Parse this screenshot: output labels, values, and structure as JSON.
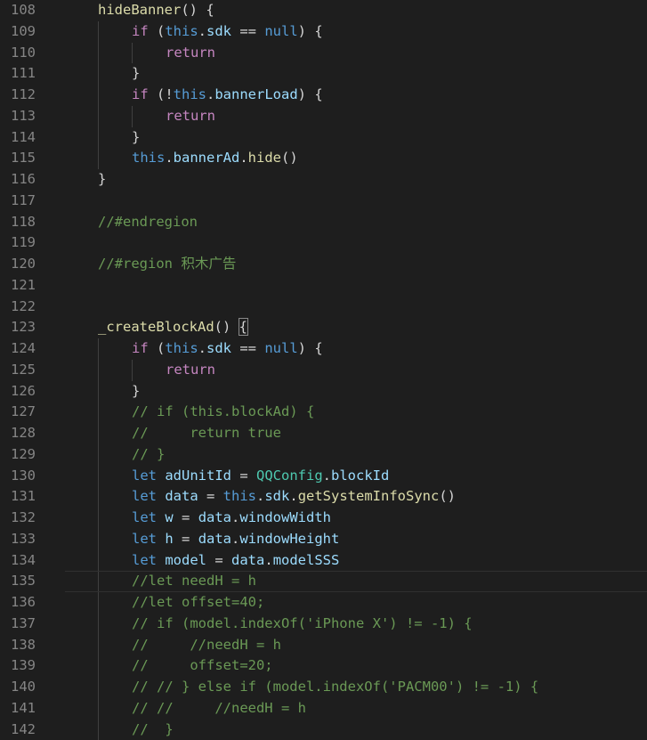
{
  "editor": {
    "colors": {
      "background": "#1e1e1e",
      "line_number": "#858585",
      "function": "#dcdcaa",
      "keyword": "#c586c0",
      "constant": "#569cd6",
      "variable": "#9cdcfe",
      "class": "#4ec9b0",
      "comment": "#6a9955",
      "text": "#d4d4d4"
    },
    "current_line": 135,
    "lines": [
      {
        "n": "108",
        "indent": 1,
        "tokens": [
          {
            "t": "hideBanner",
            "c": "func"
          },
          {
            "t": "() {",
            "c": "plain"
          }
        ]
      },
      {
        "n": "109",
        "indent": 2,
        "tokens": [
          {
            "t": "if",
            "c": "kw"
          },
          {
            "t": " (",
            "c": "plain"
          },
          {
            "t": "this",
            "c": "const"
          },
          {
            "t": ".",
            "c": "plain"
          },
          {
            "t": "sdk",
            "c": "var"
          },
          {
            "t": " == ",
            "c": "plain"
          },
          {
            "t": "null",
            "c": "const"
          },
          {
            "t": ") {",
            "c": "plain"
          }
        ]
      },
      {
        "n": "110",
        "indent": 3,
        "tokens": [
          {
            "t": "return",
            "c": "kw"
          }
        ]
      },
      {
        "n": "111",
        "indent": 2,
        "tokens": [
          {
            "t": "}",
            "c": "plain"
          }
        ]
      },
      {
        "n": "112",
        "indent": 2,
        "tokens": [
          {
            "t": "if",
            "c": "kw"
          },
          {
            "t": " (!",
            "c": "plain"
          },
          {
            "t": "this",
            "c": "const"
          },
          {
            "t": ".",
            "c": "plain"
          },
          {
            "t": "bannerLoad",
            "c": "var"
          },
          {
            "t": ") {",
            "c": "plain"
          }
        ]
      },
      {
        "n": "113",
        "indent": 3,
        "tokens": [
          {
            "t": "return",
            "c": "kw"
          }
        ]
      },
      {
        "n": "114",
        "indent": 2,
        "tokens": [
          {
            "t": "}",
            "c": "plain"
          }
        ]
      },
      {
        "n": "115",
        "indent": 2,
        "tokens": [
          {
            "t": "this",
            "c": "const"
          },
          {
            "t": ".",
            "c": "plain"
          },
          {
            "t": "bannerAd",
            "c": "var"
          },
          {
            "t": ".",
            "c": "plain"
          },
          {
            "t": "hide",
            "c": "func"
          },
          {
            "t": "()",
            "c": "plain"
          }
        ]
      },
      {
        "n": "116",
        "indent": 1,
        "tokens": [
          {
            "t": "}",
            "c": "plain"
          }
        ]
      },
      {
        "n": "117",
        "indent": 0,
        "tokens": []
      },
      {
        "n": "118",
        "indent": 1,
        "tokens": [
          {
            "t": "//#endregion",
            "c": "comment"
          }
        ]
      },
      {
        "n": "119",
        "indent": 0,
        "tokens": []
      },
      {
        "n": "120",
        "indent": 1,
        "tokens": [
          {
            "t": "//#region 积木广告",
            "c": "comment"
          }
        ]
      },
      {
        "n": "121",
        "indent": 0,
        "tokens": []
      },
      {
        "n": "122",
        "indent": 0,
        "tokens": []
      },
      {
        "n": "123",
        "indent": 1,
        "tokens": [
          {
            "t": "_createBlockAd",
            "c": "func"
          },
          {
            "t": "() ",
            "c": "plain"
          },
          {
            "t": "{",
            "c": "bracket"
          }
        ]
      },
      {
        "n": "124",
        "indent": 2,
        "tokens": [
          {
            "t": "if",
            "c": "kw"
          },
          {
            "t": " (",
            "c": "plain"
          },
          {
            "t": "this",
            "c": "const"
          },
          {
            "t": ".",
            "c": "plain"
          },
          {
            "t": "sdk",
            "c": "var"
          },
          {
            "t": " == ",
            "c": "plain"
          },
          {
            "t": "null",
            "c": "const"
          },
          {
            "t": ") {",
            "c": "plain"
          }
        ]
      },
      {
        "n": "125",
        "indent": 3,
        "tokens": [
          {
            "t": "return",
            "c": "kw"
          }
        ]
      },
      {
        "n": "126",
        "indent": 2,
        "tokens": [
          {
            "t": "}",
            "c": "plain"
          }
        ]
      },
      {
        "n": "127",
        "indent": 2,
        "tokens": [
          {
            "t": "// if (this.blockAd) {",
            "c": "comment"
          }
        ]
      },
      {
        "n": "128",
        "indent": 2,
        "tokens": [
          {
            "t": "//     return true",
            "c": "comment"
          }
        ]
      },
      {
        "n": "129",
        "indent": 2,
        "tokens": [
          {
            "t": "// }",
            "c": "comment"
          }
        ]
      },
      {
        "n": "130",
        "indent": 2,
        "tokens": [
          {
            "t": "let",
            "c": "const"
          },
          {
            "t": " ",
            "c": "plain"
          },
          {
            "t": "adUnitId",
            "c": "var"
          },
          {
            "t": " = ",
            "c": "plain"
          },
          {
            "t": "QQConfig",
            "c": "class"
          },
          {
            "t": ".",
            "c": "plain"
          },
          {
            "t": "blockId",
            "c": "var"
          }
        ]
      },
      {
        "n": "131",
        "indent": 2,
        "tokens": [
          {
            "t": "let",
            "c": "const"
          },
          {
            "t": " ",
            "c": "plain"
          },
          {
            "t": "data",
            "c": "var"
          },
          {
            "t": " = ",
            "c": "plain"
          },
          {
            "t": "this",
            "c": "const"
          },
          {
            "t": ".",
            "c": "plain"
          },
          {
            "t": "sdk",
            "c": "var"
          },
          {
            "t": ".",
            "c": "plain"
          },
          {
            "t": "getSystemInfoSync",
            "c": "func"
          },
          {
            "t": "()",
            "c": "plain"
          }
        ]
      },
      {
        "n": "132",
        "indent": 2,
        "tokens": [
          {
            "t": "let",
            "c": "const"
          },
          {
            "t": " ",
            "c": "plain"
          },
          {
            "t": "w",
            "c": "var"
          },
          {
            "t": " = ",
            "c": "plain"
          },
          {
            "t": "data",
            "c": "var"
          },
          {
            "t": ".",
            "c": "plain"
          },
          {
            "t": "windowWidth",
            "c": "var"
          }
        ]
      },
      {
        "n": "133",
        "indent": 2,
        "tokens": [
          {
            "t": "let",
            "c": "const"
          },
          {
            "t": " ",
            "c": "plain"
          },
          {
            "t": "h",
            "c": "var"
          },
          {
            "t": " = ",
            "c": "plain"
          },
          {
            "t": "data",
            "c": "var"
          },
          {
            "t": ".",
            "c": "plain"
          },
          {
            "t": "windowHeight",
            "c": "var"
          }
        ]
      },
      {
        "n": "134",
        "indent": 2,
        "tokens": [
          {
            "t": "let",
            "c": "const"
          },
          {
            "t": " ",
            "c": "plain"
          },
          {
            "t": "model",
            "c": "var"
          },
          {
            "t": " = ",
            "c": "plain"
          },
          {
            "t": "data",
            "c": "var"
          },
          {
            "t": ".",
            "c": "plain"
          },
          {
            "t": "modelSSS",
            "c": "var"
          }
        ]
      },
      {
        "n": "135",
        "indent": 2,
        "tokens": [
          {
            "t": "//let needH = h",
            "c": "comment"
          }
        ]
      },
      {
        "n": "136",
        "indent": 2,
        "tokens": [
          {
            "t": "//let offset=40;",
            "c": "comment"
          }
        ]
      },
      {
        "n": "137",
        "indent": 2,
        "tokens": [
          {
            "t": "// if (model.indexOf('iPhone X') != -1) {",
            "c": "comment"
          }
        ]
      },
      {
        "n": "138",
        "indent": 2,
        "tokens": [
          {
            "t": "//     //needH = h",
            "c": "comment"
          }
        ]
      },
      {
        "n": "139",
        "indent": 2,
        "tokens": [
          {
            "t": "//     offset=20;",
            "c": "comment"
          }
        ]
      },
      {
        "n": "140",
        "indent": 2,
        "tokens": [
          {
            "t": "// // } else if (model.indexOf('PACM00') != -1) {",
            "c": "comment"
          }
        ]
      },
      {
        "n": "141",
        "indent": 2,
        "tokens": [
          {
            "t": "// //     //needH = h",
            "c": "comment"
          }
        ]
      },
      {
        "n": "142",
        "indent": 2,
        "tokens": [
          {
            "t": "//  }",
            "c": "comment"
          }
        ]
      }
    ]
  }
}
